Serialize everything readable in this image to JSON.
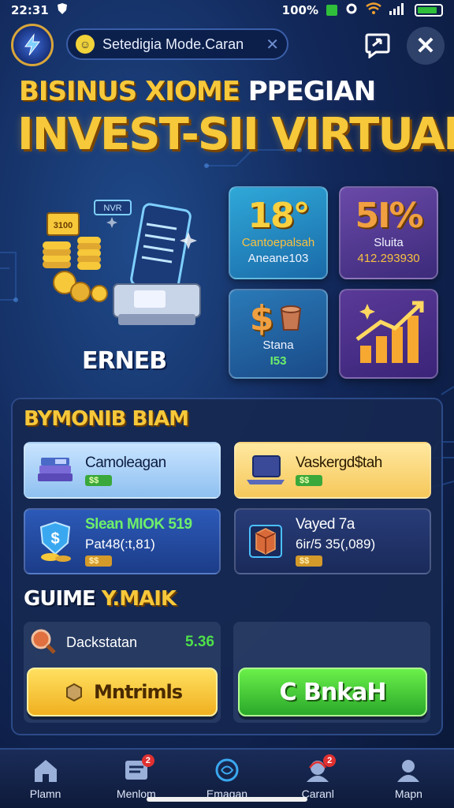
{
  "status_bar": {
    "time": "22:31",
    "network": "100%",
    "icons": [
      "shield-icon",
      "gear-icon",
      "wifi-icon",
      "signal-icon",
      "battery-icon"
    ]
  },
  "top_bar": {
    "mode_text": "Setedigia Mode.Caran",
    "close_symbol": "✕"
  },
  "title": {
    "small_gold": "BISINUS XIOME",
    "small_white": "PPEGIAN",
    "big": "INVEST-SII VIRTUAL"
  },
  "hero": {
    "label": "ERNEB",
    "screen_tag": "NVR",
    "coin_tag": "3100"
  },
  "tiles": [
    {
      "big": "18°",
      "line1": "Cantoepalsah",
      "line2": "Aneane103"
    },
    {
      "big": "5I%",
      "line1": "Sluita",
      "line2": "412.293930"
    },
    {
      "big": "$",
      "line1": "Stana",
      "line2": "I53"
    },
    {
      "big": "",
      "line1": "",
      "line2": ""
    }
  ],
  "section1": {
    "title_gold": "BYMONIB",
    "title_white": "BIAM"
  },
  "cards": [
    {
      "title": "Camoleagan",
      "sub": "",
      "chip": "$$"
    },
    {
      "title": "Vaskergd$tah",
      "sub": "",
      "chip": "$$"
    },
    {
      "title": "Slean MIOK 519",
      "sub": "Pat48(:t,81)",
      "chip": "$$"
    },
    {
      "title": "Vayed 7a",
      "sub": "6ir/5 35(,089)",
      "chip": "$$"
    }
  ],
  "section2": {
    "title_white": "GUIME",
    "title_gold": "Y.MAIK"
  },
  "game": {
    "name": "Dackstatan",
    "value": "5.36"
  },
  "buttons": {
    "yellow": "Mntrimls",
    "green": "C BnkaH"
  },
  "nav": [
    {
      "label": "Plamn",
      "icon": "home-icon",
      "badge": ""
    },
    {
      "label": "Menlom",
      "icon": "inbox-icon",
      "badge": "2"
    },
    {
      "label": "Emagan",
      "icon": "globe-icon",
      "badge": ""
    },
    {
      "label": "Caranl",
      "icon": "support-icon",
      "badge": "2"
    },
    {
      "label": "Mapn",
      "icon": "profile-icon",
      "badge": ""
    }
  ],
  "colors": {
    "accent_gold": "#f6c83a",
    "accent_green": "#4ee04a",
    "panel": "#162850",
    "background": "#12285a"
  }
}
